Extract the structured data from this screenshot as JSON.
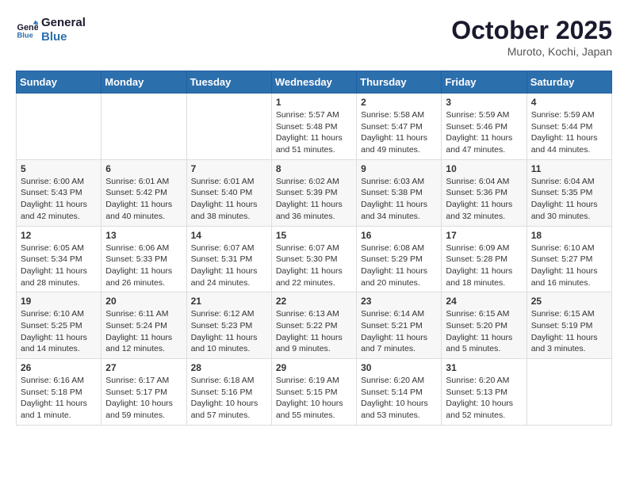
{
  "header": {
    "logo_line1": "General",
    "logo_line2": "Blue",
    "month": "October 2025",
    "location": "Muroto, Kochi, Japan"
  },
  "weekdays": [
    "Sunday",
    "Monday",
    "Tuesday",
    "Wednesday",
    "Thursday",
    "Friday",
    "Saturday"
  ],
  "weeks": [
    [
      {
        "day": "",
        "info": ""
      },
      {
        "day": "",
        "info": ""
      },
      {
        "day": "",
        "info": ""
      },
      {
        "day": "1",
        "info": "Sunrise: 5:57 AM\nSunset: 5:48 PM\nDaylight: 11 hours\nand 51 minutes."
      },
      {
        "day": "2",
        "info": "Sunrise: 5:58 AM\nSunset: 5:47 PM\nDaylight: 11 hours\nand 49 minutes."
      },
      {
        "day": "3",
        "info": "Sunrise: 5:59 AM\nSunset: 5:46 PM\nDaylight: 11 hours\nand 47 minutes."
      },
      {
        "day": "4",
        "info": "Sunrise: 5:59 AM\nSunset: 5:44 PM\nDaylight: 11 hours\nand 44 minutes."
      }
    ],
    [
      {
        "day": "5",
        "info": "Sunrise: 6:00 AM\nSunset: 5:43 PM\nDaylight: 11 hours\nand 42 minutes."
      },
      {
        "day": "6",
        "info": "Sunrise: 6:01 AM\nSunset: 5:42 PM\nDaylight: 11 hours\nand 40 minutes."
      },
      {
        "day": "7",
        "info": "Sunrise: 6:01 AM\nSunset: 5:40 PM\nDaylight: 11 hours\nand 38 minutes."
      },
      {
        "day": "8",
        "info": "Sunrise: 6:02 AM\nSunset: 5:39 PM\nDaylight: 11 hours\nand 36 minutes."
      },
      {
        "day": "9",
        "info": "Sunrise: 6:03 AM\nSunset: 5:38 PM\nDaylight: 11 hours\nand 34 minutes."
      },
      {
        "day": "10",
        "info": "Sunrise: 6:04 AM\nSunset: 5:36 PM\nDaylight: 11 hours\nand 32 minutes."
      },
      {
        "day": "11",
        "info": "Sunrise: 6:04 AM\nSunset: 5:35 PM\nDaylight: 11 hours\nand 30 minutes."
      }
    ],
    [
      {
        "day": "12",
        "info": "Sunrise: 6:05 AM\nSunset: 5:34 PM\nDaylight: 11 hours\nand 28 minutes."
      },
      {
        "day": "13",
        "info": "Sunrise: 6:06 AM\nSunset: 5:33 PM\nDaylight: 11 hours\nand 26 minutes."
      },
      {
        "day": "14",
        "info": "Sunrise: 6:07 AM\nSunset: 5:31 PM\nDaylight: 11 hours\nand 24 minutes."
      },
      {
        "day": "15",
        "info": "Sunrise: 6:07 AM\nSunset: 5:30 PM\nDaylight: 11 hours\nand 22 minutes."
      },
      {
        "day": "16",
        "info": "Sunrise: 6:08 AM\nSunset: 5:29 PM\nDaylight: 11 hours\nand 20 minutes."
      },
      {
        "day": "17",
        "info": "Sunrise: 6:09 AM\nSunset: 5:28 PM\nDaylight: 11 hours\nand 18 minutes."
      },
      {
        "day": "18",
        "info": "Sunrise: 6:10 AM\nSunset: 5:27 PM\nDaylight: 11 hours\nand 16 minutes."
      }
    ],
    [
      {
        "day": "19",
        "info": "Sunrise: 6:10 AM\nSunset: 5:25 PM\nDaylight: 11 hours\nand 14 minutes."
      },
      {
        "day": "20",
        "info": "Sunrise: 6:11 AM\nSunset: 5:24 PM\nDaylight: 11 hours\nand 12 minutes."
      },
      {
        "day": "21",
        "info": "Sunrise: 6:12 AM\nSunset: 5:23 PM\nDaylight: 11 hours\nand 10 minutes."
      },
      {
        "day": "22",
        "info": "Sunrise: 6:13 AM\nSunset: 5:22 PM\nDaylight: 11 hours\nand 9 minutes."
      },
      {
        "day": "23",
        "info": "Sunrise: 6:14 AM\nSunset: 5:21 PM\nDaylight: 11 hours\nand 7 minutes."
      },
      {
        "day": "24",
        "info": "Sunrise: 6:15 AM\nSunset: 5:20 PM\nDaylight: 11 hours\nand 5 minutes."
      },
      {
        "day": "25",
        "info": "Sunrise: 6:15 AM\nSunset: 5:19 PM\nDaylight: 11 hours\nand 3 minutes."
      }
    ],
    [
      {
        "day": "26",
        "info": "Sunrise: 6:16 AM\nSunset: 5:18 PM\nDaylight: 11 hours\nand 1 minute."
      },
      {
        "day": "27",
        "info": "Sunrise: 6:17 AM\nSunset: 5:17 PM\nDaylight: 10 hours\nand 59 minutes."
      },
      {
        "day": "28",
        "info": "Sunrise: 6:18 AM\nSunset: 5:16 PM\nDaylight: 10 hours\nand 57 minutes."
      },
      {
        "day": "29",
        "info": "Sunrise: 6:19 AM\nSunset: 5:15 PM\nDaylight: 10 hours\nand 55 minutes."
      },
      {
        "day": "30",
        "info": "Sunrise: 6:20 AM\nSunset: 5:14 PM\nDaylight: 10 hours\nand 53 minutes."
      },
      {
        "day": "31",
        "info": "Sunrise: 6:20 AM\nSunset: 5:13 PM\nDaylight: 10 hours\nand 52 minutes."
      },
      {
        "day": "",
        "info": ""
      }
    ]
  ]
}
